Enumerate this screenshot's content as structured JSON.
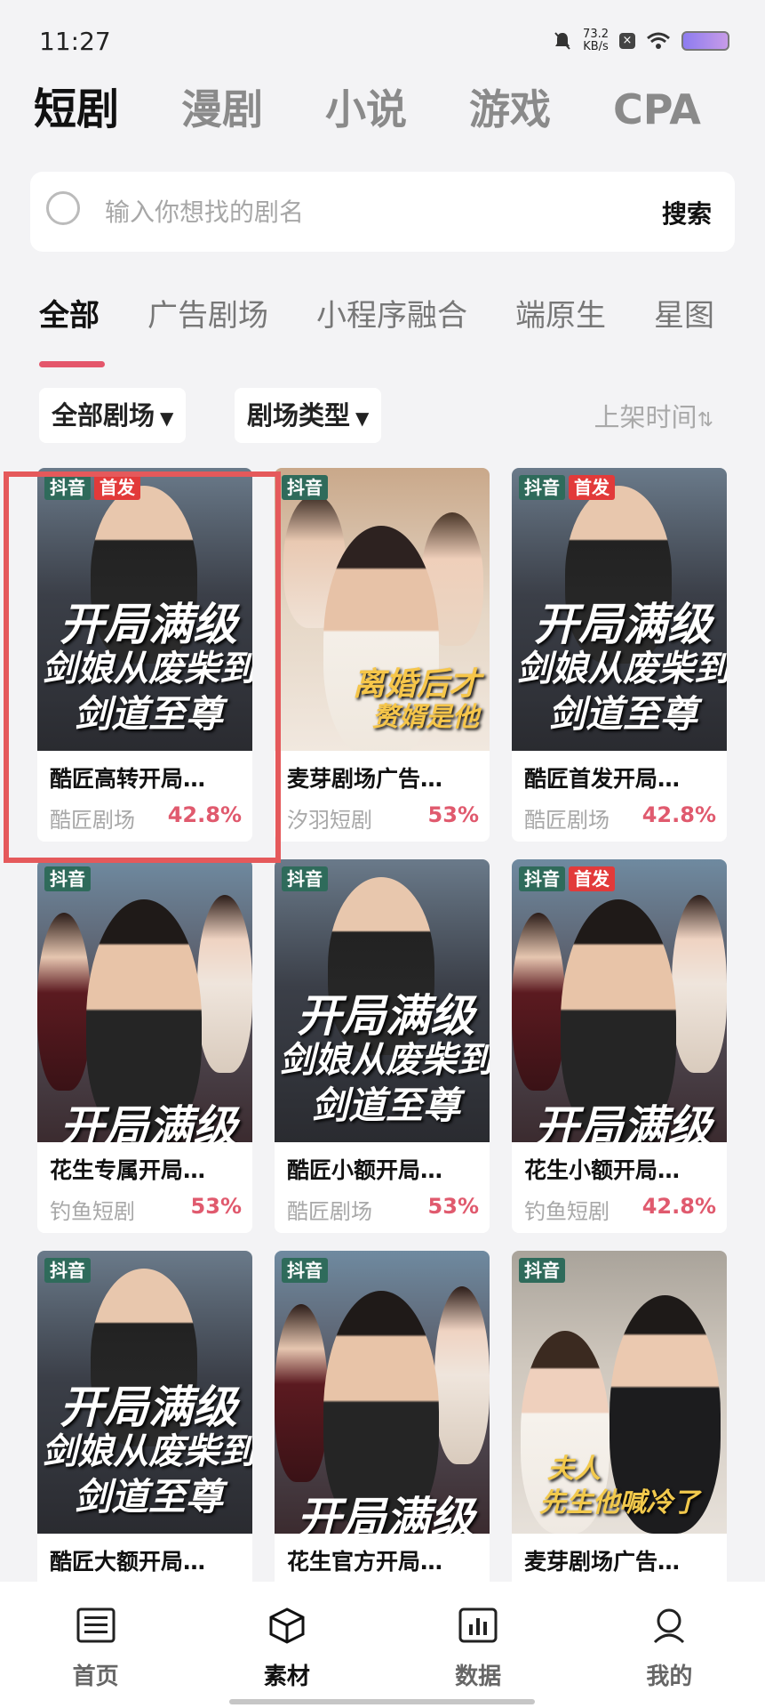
{
  "status_bar": {
    "time": "11:27",
    "speed_value": "73.2",
    "speed_unit": "KB/s"
  },
  "top_tabs": [
    "短剧",
    "漫剧",
    "小说",
    "游戏",
    "CPA"
  ],
  "search": {
    "placeholder": "输入你想找的剧名",
    "button": "搜索"
  },
  "category_tabs": [
    "全部",
    "广告剧场",
    "小程序融合",
    "端原生",
    "星图"
  ],
  "filters": {
    "theater": "全部剧场",
    "type": "剧场类型",
    "sort": "上架时间"
  },
  "cards": [
    {
      "title": "酷匠高转开局…",
      "source": "酷匠剧场",
      "rate": "42.8%",
      "platform_tag": "抖音",
      "first_tag": "首发",
      "poster_text": [
        "开局满级",
        "剑娘从废柴到",
        "剑道至尊"
      ]
    },
    {
      "title": "麦芽剧场广告…",
      "source": "汐羽短剧",
      "rate": "53%",
      "platform_tag": "抖音",
      "first_tag": "",
      "poster_text": [
        "离婚后才",
        "赘婿是他"
      ]
    },
    {
      "title": "酷匠首发开局…",
      "source": "酷匠剧场",
      "rate": "42.8%",
      "platform_tag": "抖音",
      "first_tag": "首发",
      "poster_text": [
        "开局满级",
        "剑娘从废柴到",
        "剑道至尊"
      ]
    },
    {
      "title": "花生专属开局…",
      "source": "钓鱼短剧",
      "rate": "53%",
      "platform_tag": "抖音",
      "first_tag": "",
      "poster_text": [
        "开局满级"
      ]
    },
    {
      "title": "酷匠小额开局…",
      "source": "酷匠剧场",
      "rate": "53%",
      "platform_tag": "抖音",
      "first_tag": "",
      "poster_text": [
        "开局满级",
        "剑娘从废柴到",
        "剑道至尊"
      ]
    },
    {
      "title": "花生小额开局…",
      "source": "钓鱼短剧",
      "rate": "42.8%",
      "platform_tag": "抖音",
      "first_tag": "首发",
      "poster_text": [
        "开局满级"
      ]
    },
    {
      "title": "酷匠大额开局…",
      "source": "",
      "rate": "",
      "platform_tag": "抖音",
      "first_tag": "",
      "poster_text": [
        "开局满级",
        "剑娘从废柴到",
        "剑道至尊"
      ]
    },
    {
      "title": "花生官方开局…",
      "source": "",
      "rate": "",
      "platform_tag": "抖音",
      "first_tag": "",
      "poster_text": [
        "开局满级"
      ]
    },
    {
      "title": "麦芽剧场广告…",
      "source": "",
      "rate": "",
      "platform_tag": "抖音",
      "first_tag": "",
      "poster_text": [
        "夫人",
        "先生他喊冷了"
      ]
    }
  ],
  "bottom_nav": [
    {
      "label": "首页",
      "icon": "home-logo-icon"
    },
    {
      "label": "素材",
      "icon": "cube-icon"
    },
    {
      "label": "数据",
      "icon": "bar-chart-icon"
    },
    {
      "label": "我的",
      "icon": "user-icon"
    }
  ],
  "colors": {
    "accent": "#e4566b",
    "rate": "#e05a6e",
    "douyin_tag": "#2f6b5b",
    "first_tag": "#e23a3a",
    "highlight_box": "#e5595b"
  }
}
